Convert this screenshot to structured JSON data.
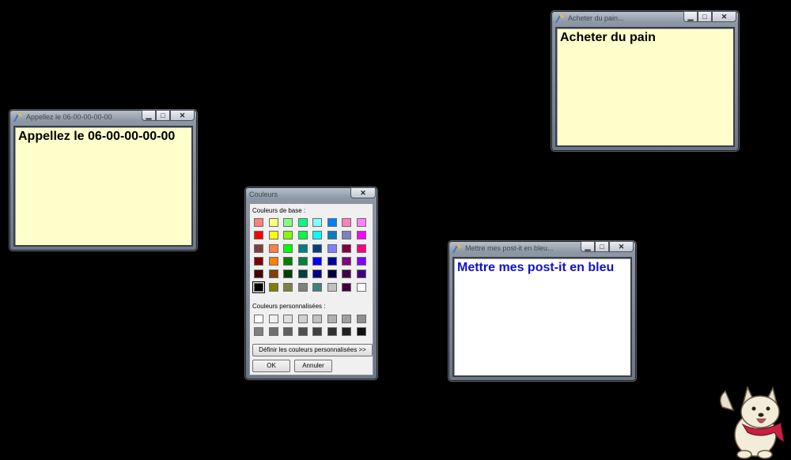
{
  "notes": [
    {
      "title": "Appellez le 06-00-00-00-00",
      "text": "Appellez le 06-00-00-00-00",
      "bg": "#ffffcc",
      "color": "#000000"
    },
    {
      "title": "Acheter du pain...",
      "text": "Acheter du pain",
      "bg": "#ffffcc",
      "color": "#000000"
    },
    {
      "title": "Mettre mes post-it en bleu...",
      "text": "Mettre mes post-it en bleu",
      "bg": "#ffffff",
      "color": "#1010d0"
    }
  ],
  "dialog": {
    "title": "Couleurs",
    "basic_label": "Couleurs de base :",
    "custom_label": "Couleurs personnalisées :",
    "define_label": "Définir les couleurs personnalisées >>",
    "ok_label": "OK",
    "cancel_label": "Annuler",
    "basic_colors": [
      [
        "#ff8080",
        "#ffff80",
        "#80ff80",
        "#00ff80",
        "#80ffff",
        "#0080ff",
        "#ff80c0",
        "#ff80ff"
      ],
      [
        "#ff0000",
        "#ffff00",
        "#80ff00",
        "#00ff40",
        "#00ffff",
        "#0080c0",
        "#8080c0",
        "#ff00ff"
      ],
      [
        "#804040",
        "#ff8040",
        "#00ff00",
        "#008080",
        "#004080",
        "#8080ff",
        "#800040",
        "#ff0080"
      ],
      [
        "#800000",
        "#ff8000",
        "#008000",
        "#008040",
        "#0000ff",
        "#0000a0",
        "#800080",
        "#8000ff"
      ],
      [
        "#400000",
        "#804000",
        "#004000",
        "#004040",
        "#000080",
        "#000040",
        "#400040",
        "#400080"
      ],
      [
        "#000000",
        "#808000",
        "#808040",
        "#808080",
        "#408080",
        "#c0c0c0",
        "#400040",
        "#ffffff"
      ]
    ],
    "selected_basic": [
      5,
      0
    ],
    "custom_colors": [
      [
        "#ffffff",
        "#f0f0f0",
        "#e0e0e0",
        "#d0d0d0",
        "#c0c0c0",
        "#b0b0b0",
        "#a0a0a0",
        "#909090"
      ],
      [
        "#808080",
        "#707070",
        "#606060",
        "#505050",
        "#404040",
        "#303030",
        "#202020",
        "#101010"
      ]
    ]
  }
}
